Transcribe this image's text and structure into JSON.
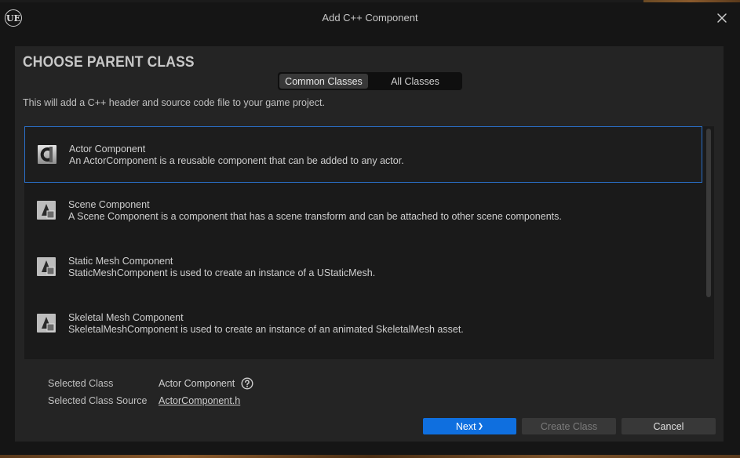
{
  "window": {
    "title": "Add C++ Component",
    "logo": "UE"
  },
  "colors": {
    "accent": "#0f6fdf",
    "selection_border": "#2a6fc8",
    "panel_bg": "#242424",
    "list_bg": "#1a1a1a"
  },
  "icons": {
    "logo": "unreal-engine-logo-icon",
    "close": "close-icon",
    "class": "cpp-class-icon",
    "component": "scene-component-icon",
    "help": "help-icon",
    "next": "chevron-right-icon"
  },
  "main": {
    "heading": "CHOOSE PARENT CLASS",
    "tabs": [
      {
        "label": "Common Classes",
        "active": true
      },
      {
        "label": "All Classes",
        "active": false
      }
    ],
    "description": "This will add a C++ header and source code file to your game project."
  },
  "classes": [
    {
      "name": "Actor Component",
      "description": "An ActorComponent is a reusable component that can be added to any actor.",
      "icon": "cpp-class-icon",
      "selected": true
    },
    {
      "name": "Scene Component",
      "description": "A Scene Component is a component that has a scene transform and can be attached to other scene components.",
      "icon": "scene-component-icon",
      "selected": false
    },
    {
      "name": "Static Mesh Component",
      "description": "StaticMeshComponent is used to create an instance of a UStaticMesh.",
      "icon": "static-mesh-component-icon",
      "selected": false
    },
    {
      "name": "Skeletal Mesh Component",
      "description": "SkeletalMeshComponent is used to create an instance of an animated SkeletalMesh asset.",
      "icon": "skeletal-mesh-component-icon",
      "selected": false
    }
  ],
  "info": {
    "selected_class_label": "Selected Class",
    "selected_class_value": "Actor Component",
    "selected_source_label": "Selected Class Source",
    "selected_source_value": "ActorComponent.h"
  },
  "footer": {
    "next_label": "Next",
    "next_glyph": "❯",
    "create_label": "Create Class",
    "cancel_label": "Cancel"
  }
}
